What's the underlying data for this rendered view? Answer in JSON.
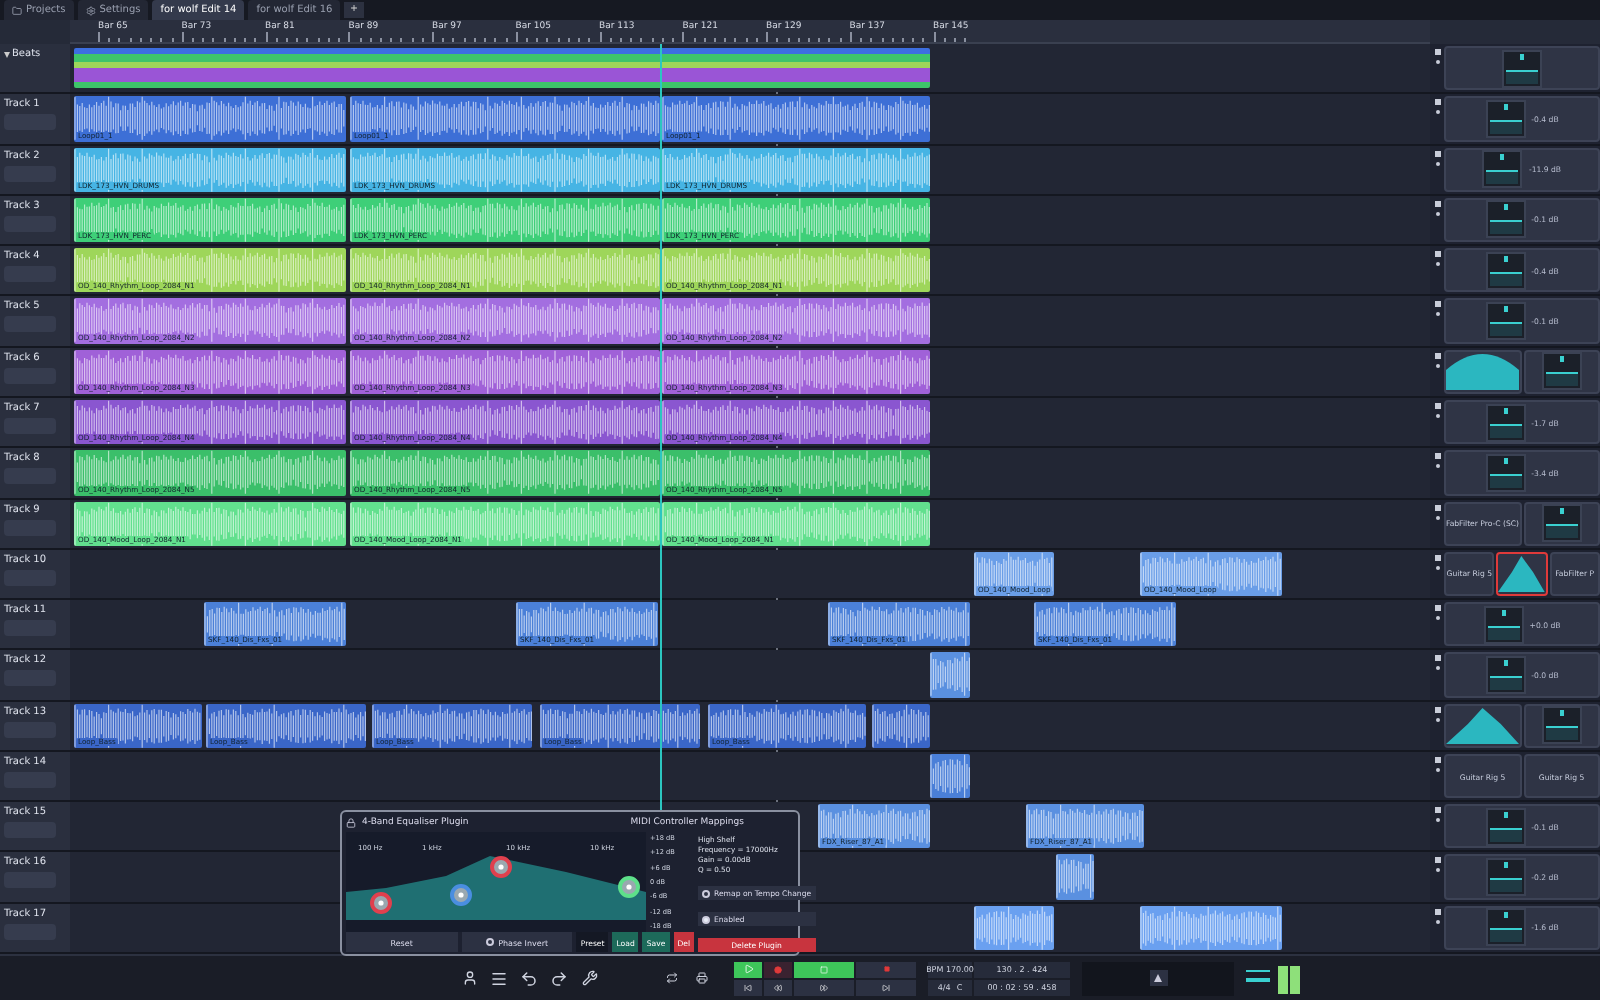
{
  "tabs": [
    {
      "label": "Projects",
      "kind": "folder",
      "selected": false
    },
    {
      "label": "Settings",
      "kind": "gear",
      "selected": false
    },
    {
      "label": "for wolf Edit 14",
      "kind": "edit",
      "selected": true
    },
    {
      "label": "for wolf Edit 16",
      "kind": "edit",
      "selected": false
    }
  ],
  "add_tab": "+",
  "ruler": [
    "Bar 65",
    "Bar 73",
    "Bar 81",
    "Bar 89",
    "Bar 97",
    "Bar 105",
    "Bar 113",
    "Bar 121",
    "Bar 129",
    "Bar 137",
    "Bar 145"
  ],
  "tracks": [
    {
      "name": "Beats",
      "kind": "folder",
      "color": "#3d6ee0",
      "plugins": [
        {
          "kind": "fader",
          "selected": false
        }
      ]
    },
    {
      "name": "Track 1",
      "kind": "audio",
      "color": "#3d6fd6",
      "clips": [
        {
          "label": "Loop01_1"
        },
        {
          "label": "Loop01_1"
        },
        {
          "label": "Loop01_1"
        }
      ],
      "plugins": [
        {
          "kind": "fader",
          "reading": "-0.4 dB",
          "selected": false
        }
      ]
    },
    {
      "name": "Track 2",
      "kind": "audio",
      "color": "#46b4e4",
      "clips": [
        {
          "label": "LDK_173_HVN_DRUMS"
        },
        {
          "label": "LDK_173_HVN_DRUMS"
        },
        {
          "label": "LDK_173_HVN_DRUMS"
        }
      ],
      "plugins": [
        {
          "kind": "fader",
          "reading": "-11.9 dB",
          "selected": false
        }
      ]
    },
    {
      "name": "Track 3",
      "kind": "audio",
      "color": "#3ecf78",
      "clips": [
        {
          "label": "LDK_173_HVN_PERC"
        },
        {
          "label": "LDK_173_HVN_PERC"
        },
        {
          "label": "LDK_173_HVN_PERC"
        }
      ],
      "plugins": [
        {
          "kind": "fader",
          "reading": "-0.1 dB",
          "selected": false
        }
      ]
    },
    {
      "name": "Track 4",
      "kind": "audio",
      "color": "#9ed65a",
      "clips": [
        {
          "label": "OD_140_Rhythm_Loop_2084_N1"
        },
        {
          "label": "OD_140_Rhythm_Loop_2084_N1"
        },
        {
          "label": "OD_140_Rhythm_Loop_2084_N1"
        }
      ],
      "plugins": [
        {
          "kind": "fader",
          "reading": "-0.4 dB",
          "selected": false
        }
      ]
    },
    {
      "name": "Track 5",
      "kind": "audio",
      "color": "#a36ee0",
      "clips": [
        {
          "label": "OD_140_Rhythm_Loop_2084_N2"
        },
        {
          "label": "OD_140_Rhythm_Loop_2084_N2"
        },
        {
          "label": "OD_140_Rhythm_Loop_2084_N2"
        }
      ],
      "plugins": [
        {
          "kind": "fader",
          "reading": "-0.1 dB",
          "selected": false
        }
      ]
    },
    {
      "name": "Track 6",
      "kind": "audio",
      "color": "#a061d8",
      "clips": [
        {
          "label": "OD_140_Rhythm_Loop_2084_N3"
        },
        {
          "label": "OD_140_Rhythm_Loop_2084_N3"
        },
        {
          "label": "OD_140_Rhythm_Loop_2084_N3"
        }
      ],
      "plugins": [
        {
          "kind": "curve",
          "selected": false
        },
        {
          "kind": "fader",
          "selected": false
        }
      ]
    },
    {
      "name": "Track 7",
      "kind": "audio",
      "color": "#8a56d0",
      "clips": [
        {
          "label": "OD_140_Rhythm_Loop_2084_N4"
        },
        {
          "label": "OD_140_Rhythm_Loop_2084_N4"
        },
        {
          "label": "OD_140_Rhythm_Loop_2084_N4"
        }
      ],
      "plugins": [
        {
          "kind": "fader",
          "reading": "-1.7 dB",
          "selected": false
        }
      ]
    },
    {
      "name": "Track 8",
      "kind": "audio",
      "color": "#3bbf6a",
      "clips": [
        {
          "label": "OD_140_Rhythm_Loop_2084_N5"
        },
        {
          "label": "OD_140_Rhythm_Loop_2084_N5"
        },
        {
          "label": "OD_140_Rhythm_Loop_2084_N5"
        }
      ],
      "plugins": [
        {
          "kind": "fader",
          "reading": "-3.4 dB",
          "selected": false
        }
      ]
    },
    {
      "name": "Track 9",
      "kind": "audio",
      "color": "#62e08e",
      "clips": [
        {
          "label": "OD_140_Mood_Loop_2084_N1"
        },
        {
          "label": "OD_140_Mood_Loop_2084_N1"
        },
        {
          "label": "OD_140_Mood_Loop_2084_N1"
        }
      ],
      "plugins": [
        {
          "kind": "name",
          "label": "FabFilter Pro-C (SC)",
          "selected": false
        },
        {
          "kind": "fader",
          "selected": false
        }
      ]
    },
    {
      "name": "Track 10",
      "kind": "audio",
      "color": "#6a9ee8",
      "clips": [
        {
          "label": "OD_140_Mood_Loop"
        },
        {
          "label": "OD_140_Mood_Loop"
        }
      ],
      "plugins": [
        {
          "kind": "name",
          "label": "Guitar Rig 5",
          "selected": false
        },
        {
          "kind": "curve",
          "selected": true
        },
        {
          "kind": "name",
          "label": "FabFilter P",
          "selected": false
        }
      ]
    },
    {
      "name": "Track 11",
      "kind": "audio",
      "color": "#4b80d8",
      "clips": [
        {
          "label": "SKF_140_Dis_Fxs_01"
        },
        {
          "label": "SKF_140_Dis_Fxs_01"
        },
        {
          "label": "SKF_140_Dis_Fxs_01"
        },
        {
          "label": "SKF_140_Dis_Fxs_01"
        }
      ],
      "plugins": [
        {
          "kind": "fader",
          "reading": "+0.0 dB",
          "selected": false
        }
      ]
    },
    {
      "name": "Track 12",
      "kind": "audio",
      "color": "#5a90e0",
      "clips": [
        {
          "kind": "audio"
        }
      ],
      "plugins": [
        {
          "kind": "fader",
          "reading": "-0.0 dB",
          "selected": false
        }
      ]
    },
    {
      "name": "Track 13",
      "kind": "audio",
      "color": "#3a66c8",
      "clips": [
        {
          "label": "Loop_Bass"
        },
        {
          "label": "Loop_Bass"
        },
        {
          "label": "Loop_Bass"
        },
        {
          "label": "Loop_Bass"
        },
        {
          "label": "Loop_Bass"
        },
        {
          "kind": "audio"
        }
      ],
      "plugins": [
        {
          "kind": "curve",
          "selected": false
        },
        {
          "kind": "fader",
          "selected": false
        }
      ]
    },
    {
      "name": "Track 14",
      "kind": "audio",
      "color": "#4a7fd8",
      "clips": [
        {
          "kind": "audio"
        }
      ],
      "plugins": [
        {
          "kind": "name",
          "label": "Guitar Rig 5",
          "selected": false
        },
        {
          "kind": "name",
          "label": "Guitar Rig 5",
          "selected": false
        }
      ]
    },
    {
      "name": "Track 15",
      "kind": "audio",
      "color": "#5a90e0",
      "clips": [
        {
          "label": "FDX_Riser_87_A1"
        },
        {
          "label": "FDX_Riser_87_A1"
        }
      ],
      "plugins": [
        {
          "kind": "fader",
          "reading": "-0.1 dB",
          "selected": false
        }
      ]
    },
    {
      "name": "Track 16",
      "kind": "audio",
      "color": "#5a90e0",
      "clips": [
        {
          "kind": "audio"
        }
      ],
      "plugins": [
        {
          "kind": "fader",
          "reading": "-0.2 dB",
          "selected": false
        }
      ]
    },
    {
      "name": "Track 17",
      "kind": "audio",
      "color": "#6aa0f0",
      "clips": [
        {
          "kind": "audio"
        },
        {
          "kind": "audio"
        }
      ],
      "plugins": [
        {
          "kind": "fader",
          "reading": "-1.6 dB",
          "selected": false
        }
      ]
    }
  ],
  "eq_plugin": {
    "title": "4-Band Equaliser Plugin",
    "mappings_title": "MIDI Controller Mappings",
    "freq_labels": [
      "100 Hz",
      "1 kHz",
      "10 kHz",
      "10 kHz"
    ],
    "db_labels": [
      "+18 dB",
      "+12 dB",
      "+6 dB",
      "0 dB",
      "-6 dB",
      "-12 dB",
      "-18 dB"
    ],
    "bands": [
      {
        "color": "#e0404e"
      },
      {
        "color": "#4a8ee0"
      },
      {
        "color": "#e0404e"
      },
      {
        "color": "#5ee08a"
      }
    ],
    "band_info": [
      "High Shelf",
      "Frequency = 17000Hz",
      "Gain = 0.00dB",
      "Q = 0.50"
    ],
    "reset": "Reset",
    "phase_invert": {
      "label": "Phase Invert",
      "checked": false
    },
    "preset_buttons": [
      "Preset",
      "Load",
      "Save",
      "Del"
    ],
    "remap": {
      "label": "Remap on Tempo Change",
      "checked": false
    },
    "enabled": {
      "label": "Enabled",
      "checked": true
    },
    "delete": "Delete Plugin"
  },
  "transport": {
    "bpm": "BPM 170.00",
    "signature": "4/4",
    "key": "C",
    "position": "130 . 2 . 424",
    "time": "00 : 02 : 59 . 458"
  }
}
